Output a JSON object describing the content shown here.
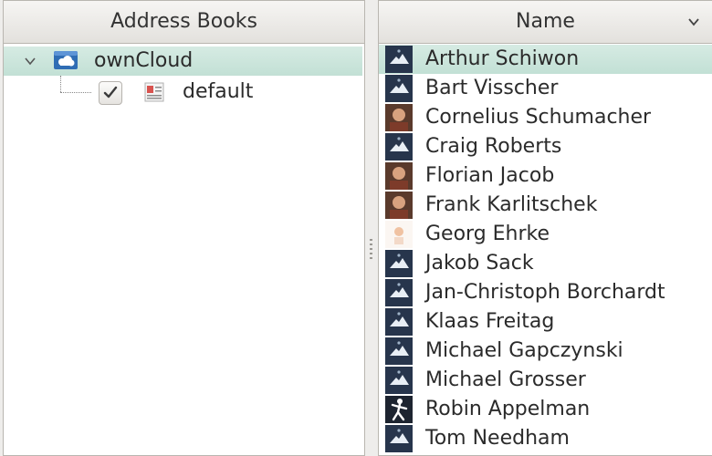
{
  "address_books": {
    "header": "Address Books",
    "tree": {
      "root": {
        "label": "ownCloud",
        "icon": "cloud-network-icon",
        "expanded": true
      },
      "children": [
        {
          "label": "default",
          "checked": true,
          "icon": "address-book-icon"
        }
      ]
    }
  },
  "contacts": {
    "header": "Name",
    "sort_icon": "chevron-down-icon",
    "items": [
      {
        "name": "Arthur Schiwon",
        "avatar": "default",
        "selected": true
      },
      {
        "name": "Bart Visscher",
        "avatar": "default"
      },
      {
        "name": "Cornelius Schumacher",
        "avatar": "photo"
      },
      {
        "name": "Craig Roberts",
        "avatar": "default"
      },
      {
        "name": "Florian Jacob",
        "avatar": "photo"
      },
      {
        "name": "Frank Karlitschek",
        "avatar": "photo"
      },
      {
        "name": "Georg Ehrke",
        "avatar": "photo-light"
      },
      {
        "name": "Jakob Sack",
        "avatar": "default"
      },
      {
        "name": "Jan-Christoph Borchardt",
        "avatar": "default"
      },
      {
        "name": "Klaas Freitag",
        "avatar": "default"
      },
      {
        "name": "Michael Gapczynski",
        "avatar": "default"
      },
      {
        "name": "Michael Grosser",
        "avatar": "default"
      },
      {
        "name": "Robin Appelman",
        "avatar": "figure"
      },
      {
        "name": "Tom Needham",
        "avatar": "default"
      }
    ]
  },
  "colors": {
    "selection": "#c9e4da",
    "avatar_bg": "#27354c"
  }
}
